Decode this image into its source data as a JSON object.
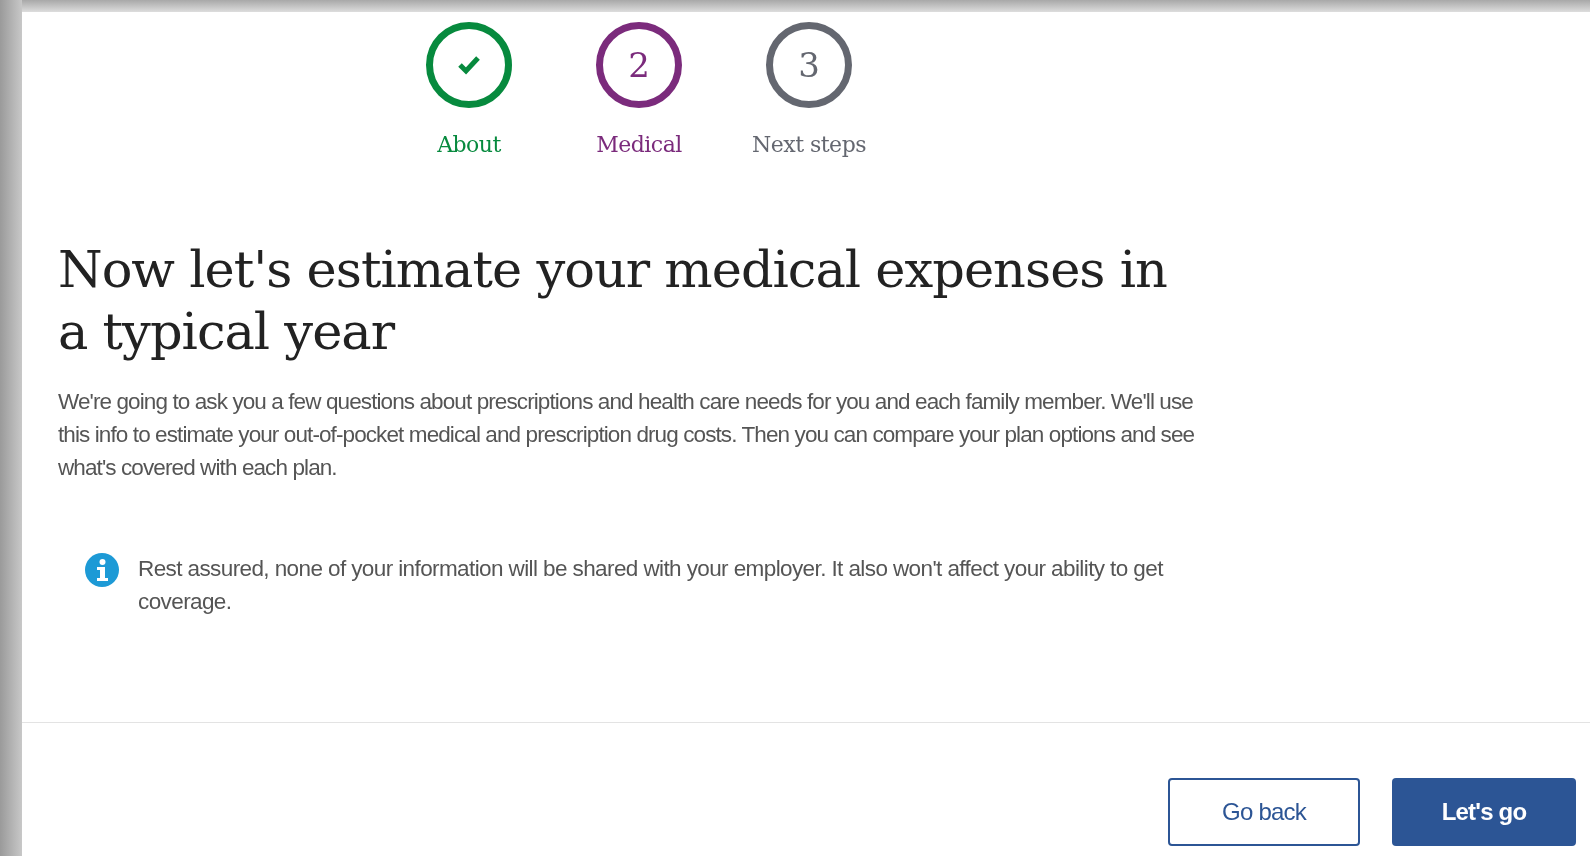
{
  "steps": [
    {
      "label": "About",
      "kind": "complete"
    },
    {
      "number": "2",
      "label": "Medical",
      "kind": "current"
    },
    {
      "number": "3",
      "label": "Next steps",
      "kind": "upcoming"
    }
  ],
  "heading": "Now let's estimate your medical expenses in a typical year",
  "intro": "We're going to ask you a few questions about prescriptions and health care needs for you and each family member. We'll use this info to estimate your out-of-pocket medical and prescription drug costs. Then you can compare your plan options and see what's covered with each plan.",
  "notice": "Rest assured, none of your information will be shared with your employer. It also won't affect your ability to get coverage.",
  "buttons": [
    {
      "label": "Go back",
      "kind": "secondary"
    },
    {
      "label": "Let's go",
      "kind": "primary"
    }
  ]
}
